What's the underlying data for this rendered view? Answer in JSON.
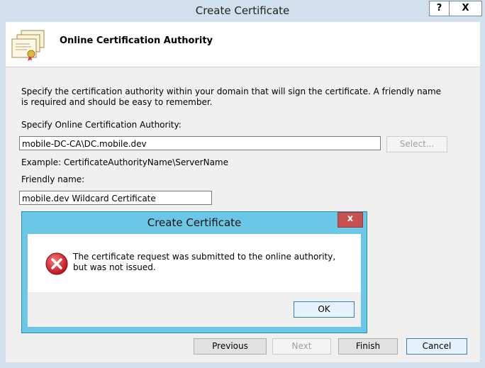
{
  "window": {
    "title": "Create Certificate",
    "help_button": "?",
    "close_button": "X"
  },
  "header": {
    "title": "Online Certification Authority",
    "icon": "certificate-icon"
  },
  "form": {
    "description": "Specify the certification authority within your domain that will sign the certificate. A friendly name is required and should be easy to remember.",
    "authority_label": "Specify Online Certification Authority:",
    "authority_value": "mobile-DC-CA\\DC.mobile.dev",
    "select_button": "Select...",
    "example_text": "Example: CertificateAuthorityName\\ServerName",
    "friendly_label": "Friendly name:",
    "friendly_value": "mobile.dev Wildcard Certificate"
  },
  "footer": {
    "previous": "Previous",
    "next": "Next",
    "finish": "Finish",
    "cancel": "Cancel"
  },
  "dialog": {
    "title": "Create Certificate",
    "close": "x",
    "icon": "error-icon",
    "message": "The certificate request was submitted to the online authority, but was not issued.",
    "ok": "OK"
  },
  "colors": {
    "dialog_frame": "#6bc7e6",
    "dialog_close": "#c75050",
    "error_red": "#d4171e"
  }
}
